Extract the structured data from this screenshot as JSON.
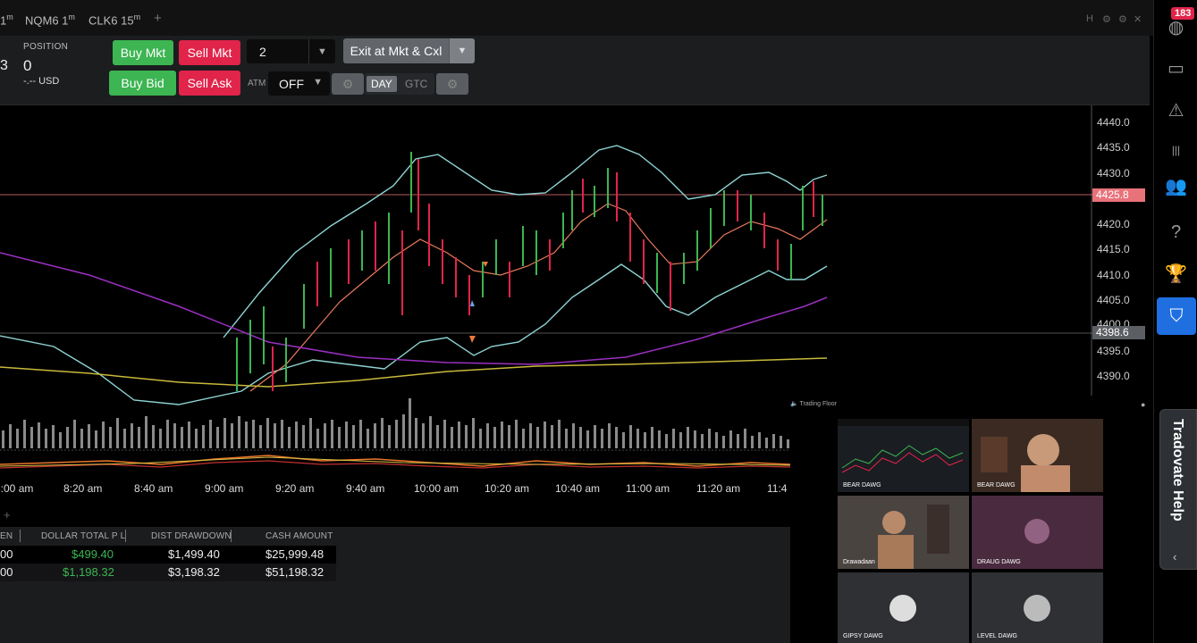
{
  "tabs": [
    {
      "label": "1",
      "sup": "m"
    },
    {
      "label": "NQM6 1",
      "sup": "m"
    },
    {
      "label": "CLK6 15",
      "sup": "m"
    }
  ],
  "tab_add": "+",
  "window_controls": {
    "h": "H",
    "gear": "⚙",
    "close": "✕"
  },
  "position": {
    "prefix": "3",
    "label": "POSITION",
    "value": "0",
    "currency": "-.-- USD"
  },
  "order": {
    "buy_mkt": "Buy Mkt",
    "sell_mkt": "Sell Mkt",
    "buy_bid": "Buy Bid",
    "sell_ask": "Sell Ask",
    "quantity": "2",
    "exit": "Exit at Mkt & Cxl",
    "atm_label": "ATM",
    "atm_value": "OFF",
    "tif_day": "DAY",
    "tif_gtc": "GTC"
  },
  "sidebar": {
    "badge": "183"
  },
  "price_axis": [
    "4440.0",
    "4435.0",
    "4430.0",
    "4420.0",
    "4415.0",
    "4410.0",
    "4405.0",
    "4400.0",
    "4395.0",
    "4390.0"
  ],
  "price_tags": {
    "last": "4425.8",
    "cursor": "4398.6"
  },
  "trading_floor_label": "Trading Floor",
  "time_axis": [
    "8:00 am",
    "8:20 am",
    "8:40 am",
    "9:00 am",
    "9:20 am",
    "9:40 am",
    "10:00 am",
    "10:20 am",
    "10:40 am",
    "11:00 am",
    "11:20 am",
    "11:4"
  ],
  "table": {
    "headers": [
      "EN",
      "DOLLAR TOTAL P L",
      "DIST DRAWDOWN",
      "CASH AMOUNT"
    ],
    "rows": [
      [
        "00",
        "$499.40",
        "$1,499.40",
        "$25,999.48"
      ],
      [
        "00",
        "$1,198.32",
        "$3,198.32",
        "$51,198.32"
      ]
    ],
    "add": "+"
  },
  "video_tiles": [
    {
      "name": "BEAR DAWG",
      "kind": "screen"
    },
    {
      "name": "BEAR DAWG",
      "kind": "person"
    },
    {
      "name": "Drawadaan",
      "kind": "person"
    },
    {
      "name": "DRAUG DAWG",
      "kind": "avatar"
    },
    {
      "name": "GIPSY DAWG",
      "kind": "avatar"
    },
    {
      "name": "LEVEL DAWG",
      "kind": "avatar"
    }
  ],
  "help": {
    "label": "Tradovate Help",
    "arrow": "‹"
  },
  "colors": {
    "buy": "#3cb552",
    "sell": "#e0244a",
    "accent": "#1f6fe0"
  }
}
